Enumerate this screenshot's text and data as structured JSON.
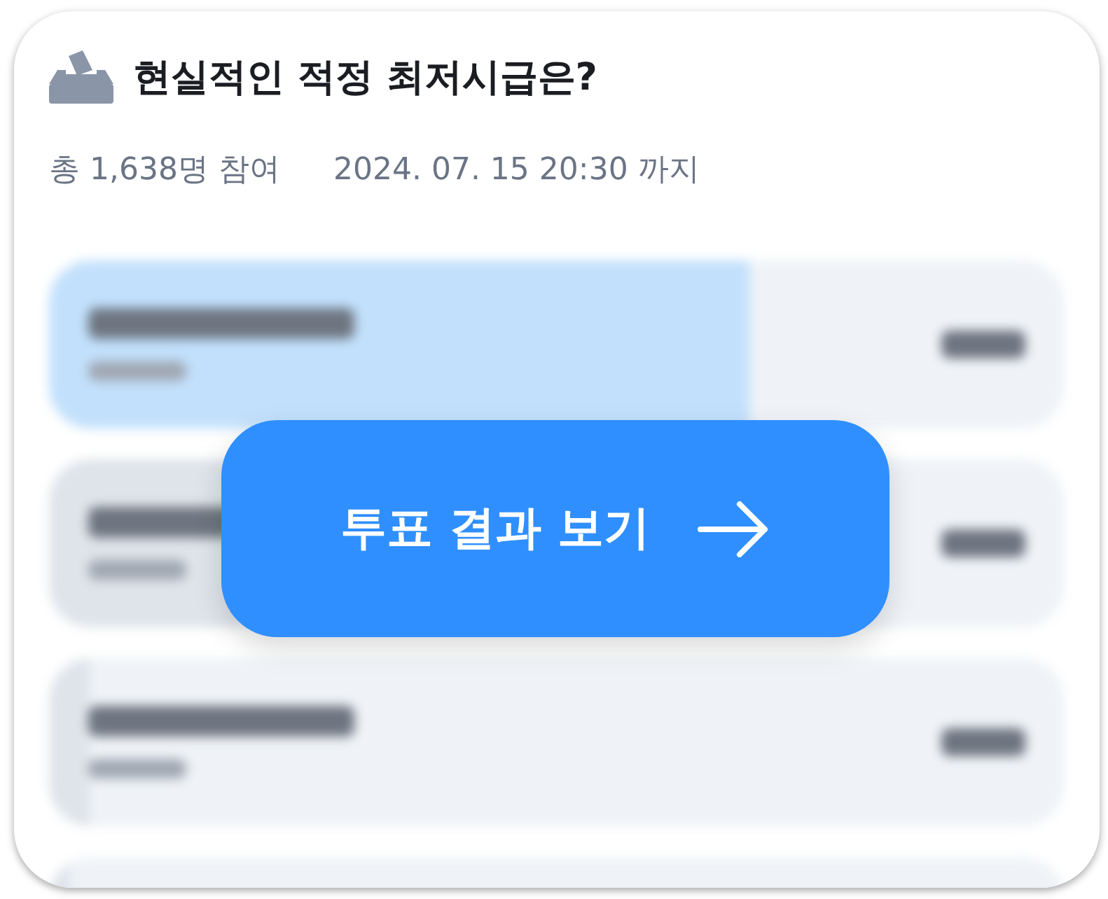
{
  "poll": {
    "title": "현실적인 적정 최저시급은?",
    "participants": "총 1,638명 참여",
    "deadline": "2024. 07. 15 20:30 까지"
  },
  "options": [
    {
      "level": 0.69,
      "selected": true
    },
    {
      "level": 0.19,
      "selected": false
    },
    {
      "level": 0.04,
      "selected": false
    },
    {
      "level": 0.02,
      "selected": false
    }
  ],
  "button": {
    "label": "투표 결과 보기"
  }
}
